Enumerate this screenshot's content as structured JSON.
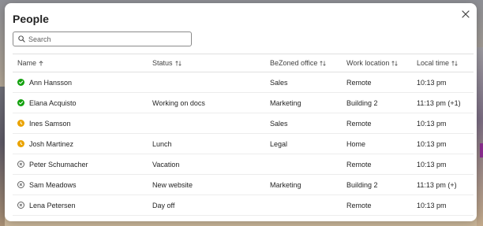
{
  "dialog": {
    "title": "People",
    "search_placeholder": "Search"
  },
  "columns": [
    {
      "label": "Name",
      "sort": "ascending-arrow-icon"
    },
    {
      "label": "Status",
      "sort": "sort-icon"
    },
    {
      "label": "BeZoned office",
      "sort": "sort-icon"
    },
    {
      "label": "Work location",
      "sort": "sort-icon"
    },
    {
      "label": "Local time",
      "sort": "sort-icon"
    }
  ],
  "rows": [
    {
      "name": "Ann Hansson",
      "presence": "available",
      "status": "",
      "office": "Sales",
      "work_location": "Remote",
      "local_time": "10:13 pm"
    },
    {
      "name": "Elana Acquisto",
      "presence": "available",
      "status": "Working on docs",
      "office": "Marketing",
      "work_location": "Building 2",
      "local_time": "11:13 pm (+1)"
    },
    {
      "name": "Ines Samson",
      "presence": "away",
      "status": "",
      "office": "Sales",
      "work_location": "Remote",
      "local_time": "10:13 pm"
    },
    {
      "name": "Josh Martinez",
      "presence": "away",
      "status": "Lunch",
      "office": "Legal",
      "work_location": "Home",
      "local_time": "10:13 pm"
    },
    {
      "name": "Peter Schumacher",
      "presence": "offline",
      "status": "Vacation",
      "office": "",
      "work_location": "Remote",
      "local_time": "10:13 pm"
    },
    {
      "name": "Sam Meadows",
      "presence": "offline",
      "status": "New website",
      "office": "Marketing",
      "work_location": "Building 2",
      "local_time": "11:13 pm (+)"
    },
    {
      "name": "Lena Petersen",
      "presence": "offline",
      "status": "Day off",
      "office": "",
      "work_location": "Remote",
      "local_time": "10:13 pm"
    }
  ],
  "colors": {
    "available": "#13a10e",
    "away": "#eaa300",
    "offline": "#616161"
  }
}
